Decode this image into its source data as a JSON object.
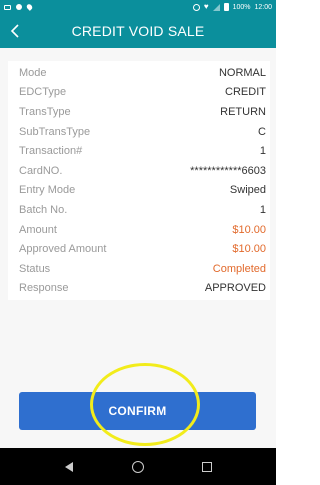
{
  "status_bar": {
    "battery": "100%",
    "time": "12:00"
  },
  "header": {
    "back_icon": "chevron-left",
    "title": "CREDIT VOID SALE"
  },
  "details": [
    {
      "label": "Mode",
      "value": "NORMAL"
    },
    {
      "label": "EDCType",
      "value": "CREDIT"
    },
    {
      "label": "TransType",
      "value": "RETURN"
    },
    {
      "label": "SubTransType",
      "value": "C"
    },
    {
      "label": "Transaction#",
      "value": "1"
    },
    {
      "label": "CardNO.",
      "value": "************6603"
    },
    {
      "label": "Entry Mode",
      "value": "Swiped"
    },
    {
      "label": "Batch No.",
      "value": "1"
    },
    {
      "label": "Amount",
      "value": "$10.00"
    },
    {
      "label": "Approved Amount",
      "value": "$10.00"
    },
    {
      "label": "Status",
      "value": "Completed"
    },
    {
      "label": "Response",
      "value": "APPROVED"
    }
  ],
  "confirm_label": "CONFIRM",
  "colors": {
    "header_bg": "#0b8f9c",
    "button_bg": "#2f6fcf",
    "accent_value": "#e26a2c",
    "highlight_ring": "#f2ec1b"
  }
}
